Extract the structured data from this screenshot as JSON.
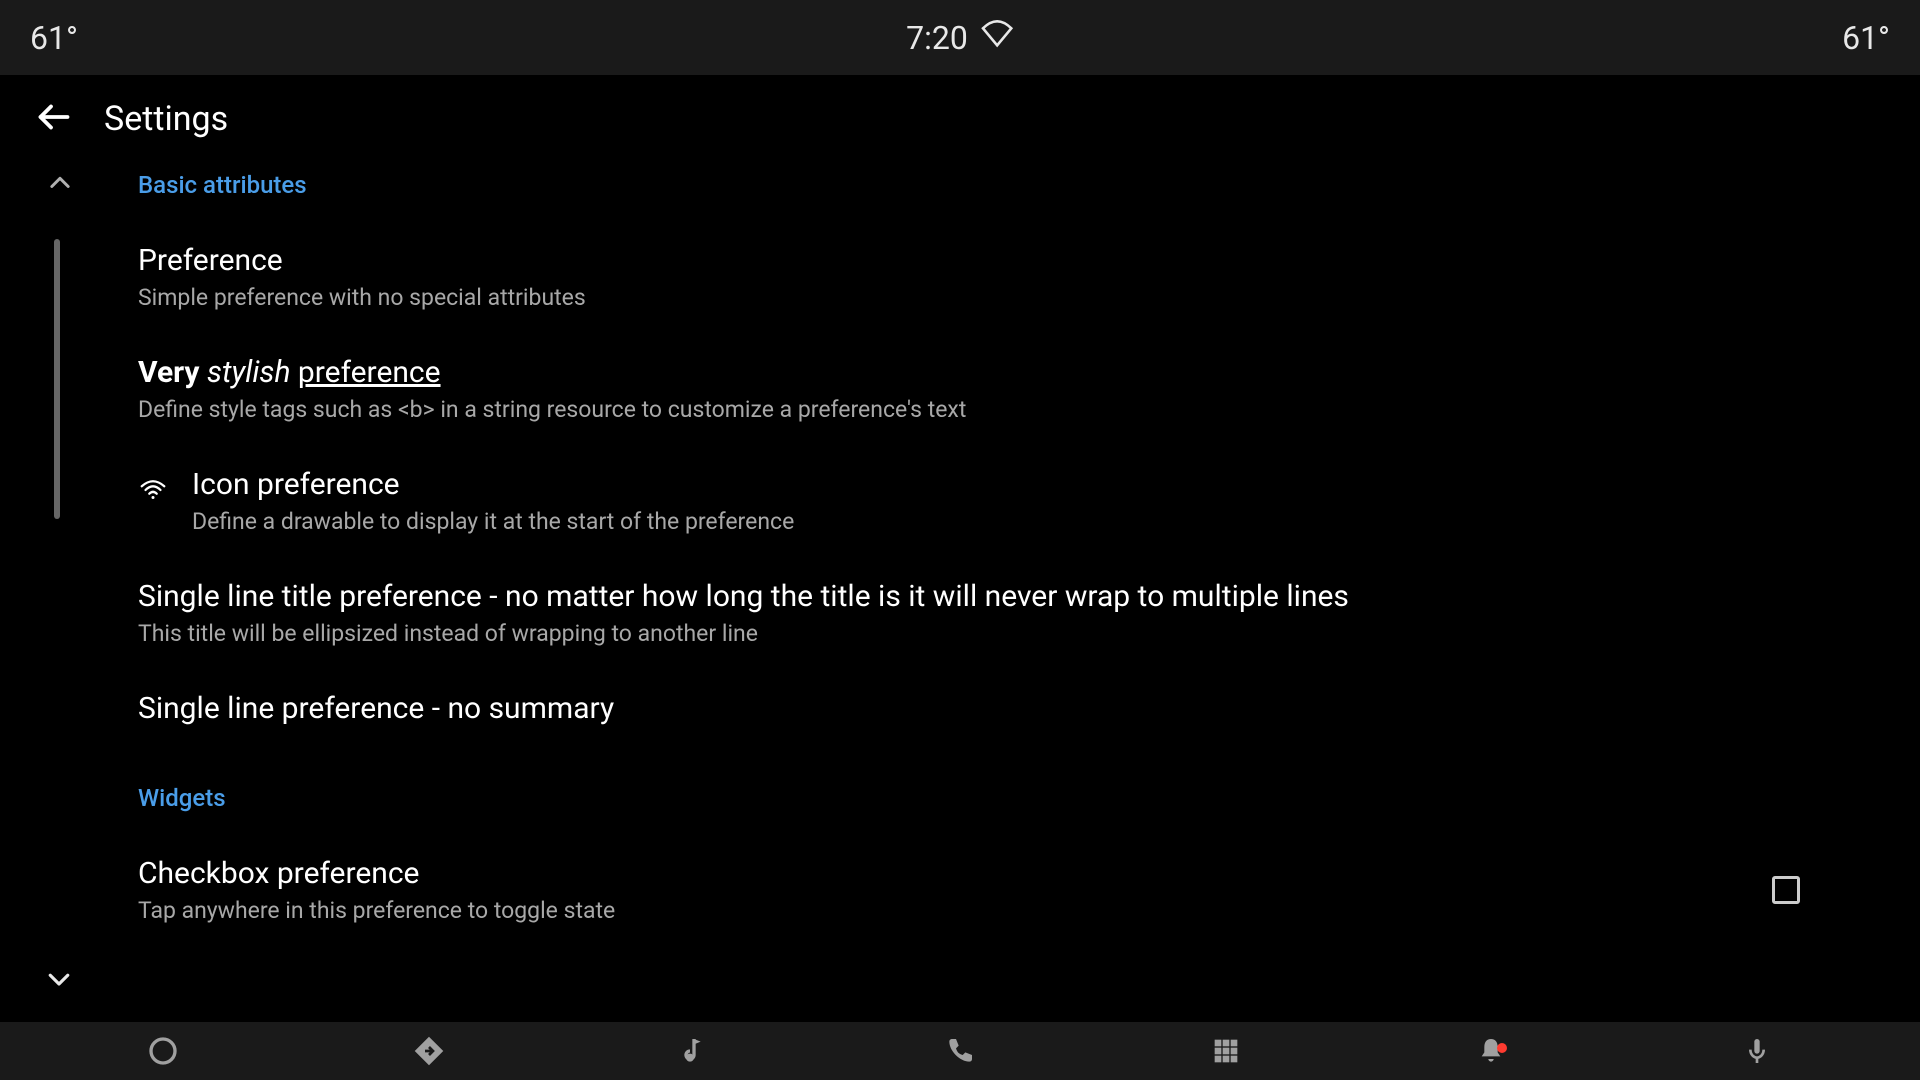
{
  "status_bar": {
    "temperature_left": "61°",
    "time": "7:20",
    "temperature_right": "61°"
  },
  "toolbar": {
    "title": "Settings"
  },
  "categories": {
    "basic": {
      "header": "Basic attributes"
    },
    "widgets": {
      "header": "Widgets"
    }
  },
  "prefs": {
    "simple": {
      "title": "Preference",
      "summary": "Simple preference with no special attributes"
    },
    "stylish": {
      "title_bold": "Very",
      "title_italic": "stylish",
      "title_underline": "preference",
      "summary": "Define style tags such as <b> in a string resource to customize a preference's text"
    },
    "icon": {
      "title": "Icon preference",
      "summary": "Define a drawable to display it at the start of the preference"
    },
    "single_line": {
      "title": "Single line title preference - no matter how long the title is it will never wrap to multiple lines",
      "summary": "This title will be ellipsized instead of wrapping to another line"
    },
    "single_line_no_summary": {
      "title": "Single line preference - no summary"
    },
    "checkbox": {
      "title": "Checkbox preference",
      "summary": "Tap anywhere in this preference to toggle state",
      "checked": false
    }
  }
}
